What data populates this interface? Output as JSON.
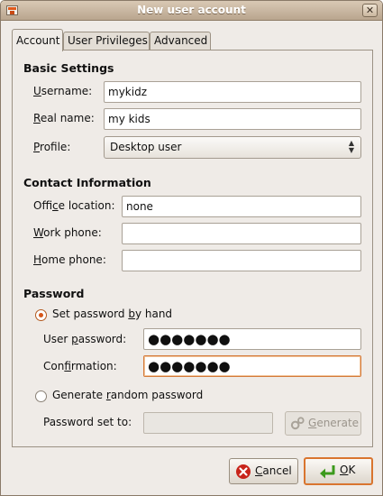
{
  "window": {
    "title": "New user account"
  },
  "tabs": [
    {
      "label": "Account",
      "active": true
    },
    {
      "label": "User Privileges",
      "active": false
    },
    {
      "label": "Advanced",
      "active": false
    }
  ],
  "basic": {
    "heading": "Basic Settings",
    "username_label_u": "U",
    "username_label_rest": "sername:",
    "username_value": "mykidz",
    "realname_label_u": "R",
    "realname_label_rest": "eal name:",
    "realname_value": "my kids",
    "profile_label_u": "P",
    "profile_label_rest": "rofile:",
    "profile_value": "Desktop user"
  },
  "contact": {
    "heading": "Contact Information",
    "office_label_pre": "Offi",
    "office_label_u": "c",
    "office_label_post": "e location:",
    "office_value": "none",
    "work_label_u": "W",
    "work_label_rest": "ork phone:",
    "work_value": "",
    "home_label_u": "H",
    "home_label_rest": "ome phone:",
    "home_value": ""
  },
  "password": {
    "heading": "Password",
    "set_by_hand_pre": "Set password ",
    "set_by_hand_u": "b",
    "set_by_hand_post": "y hand",
    "user_password_label_pre": "User ",
    "user_password_label_u": "p",
    "user_password_label_post": "assword:",
    "user_password_value": "●●●●●●●",
    "confirmation_label_pre": "Con",
    "confirmation_label_u": "f",
    "confirmation_label_post": "irmation:",
    "confirmation_value": "●●●●●●●",
    "generate_random_pre": "Generate ",
    "generate_random_u": "r",
    "generate_random_post": "andom password",
    "password_set_to_label": "Password set to:",
    "password_set_to_value": "",
    "generate_button_u": "G",
    "generate_button_rest": "enerate"
  },
  "buttons": {
    "cancel_u": "C",
    "cancel_rest": "ancel",
    "ok_u": "O",
    "ok_rest": "K"
  },
  "icons": {
    "cancel": "cancel-x-icon",
    "ok": "ok-arrow-icon",
    "generate": "generate-gear-icon",
    "close": "window-close-icon",
    "app": "users-app-icon"
  },
  "colors": {
    "focus_accent": "#d9752f",
    "radio_accent": "#d6561a",
    "ok_icon": "#3c9a1c",
    "cancel_icon": "#c8241a"
  }
}
